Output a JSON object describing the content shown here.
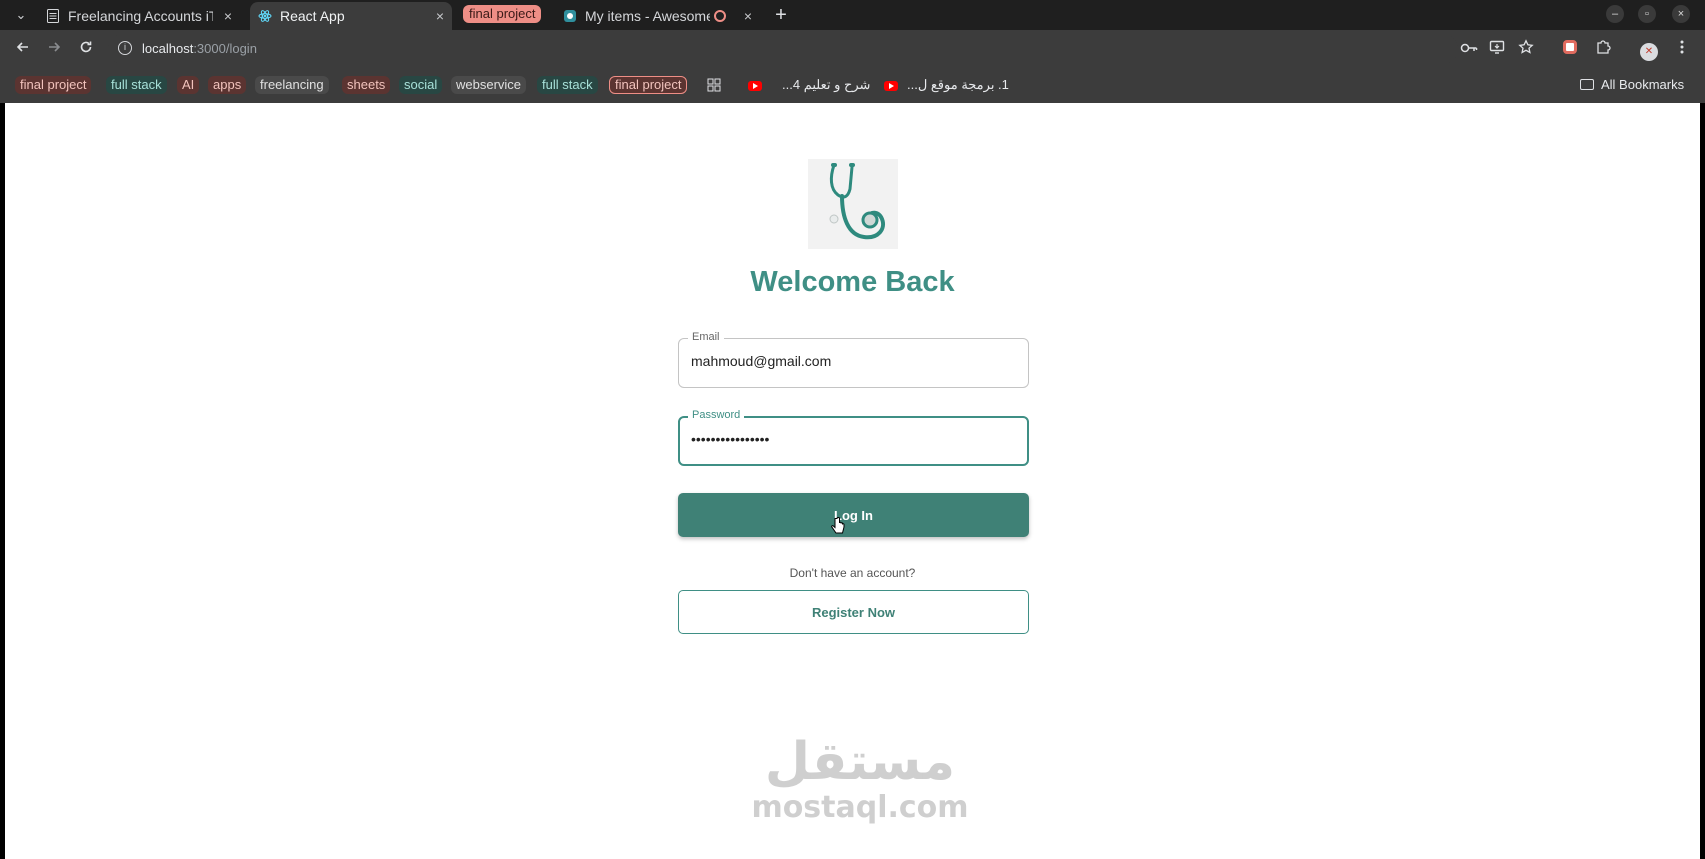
{
  "browser": {
    "tab_list_label": "⌄",
    "tabs": [
      {
        "title": "Freelancing Accounts iTi",
        "favicon": "sheets-icon",
        "close": "×"
      },
      {
        "title": "React App",
        "favicon": "react-icon",
        "close": "×"
      },
      {
        "title": "My items - Awesome",
        "favicon": "awesome-icon",
        "close": "×"
      }
    ],
    "tab_group_label": "final project",
    "new_tab": "+",
    "window": {
      "minimize": "–",
      "maximize": "▫",
      "close": "×"
    },
    "url_host": "localhost",
    "url_path": ":3000/login",
    "bookmarks": [
      {
        "label": "final project",
        "color": "red"
      },
      {
        "label": "full stack",
        "color": "teal"
      },
      {
        "label": "AI",
        "color": "red"
      },
      {
        "label": "apps",
        "color": "red"
      },
      {
        "label": "freelancing",
        "color": "grey"
      },
      {
        "label": "sheets",
        "color": "red"
      },
      {
        "label": "social",
        "color": "teal"
      },
      {
        "label": "webservice",
        "color": "grey"
      },
      {
        "label": "full stack",
        "color": "teal"
      },
      {
        "label": "final project",
        "color": "red"
      }
    ],
    "bookmark_links": [
      "شرح و تعليم 4...",
      "1. برمجة موقع ل..."
    ],
    "all_bookmarks": "All Bookmarks"
  },
  "page": {
    "logo_icon": "stethoscope-icon",
    "title": "Welcome Back",
    "email": {
      "label": "Email",
      "value": "mahmoud@gmail.com"
    },
    "password": {
      "label": "Password",
      "value": "••••••••••••••••"
    },
    "login_label": "Log In",
    "no_account_text": "Don't have an account?",
    "register_label": "Register Now"
  },
  "watermark": {
    "arabic": "مستقل",
    "latin": "mostaql.com"
  },
  "colors": {
    "primary": "#3f8176",
    "accent": "#3f8f85",
    "chrome": "#3c3c3c"
  }
}
